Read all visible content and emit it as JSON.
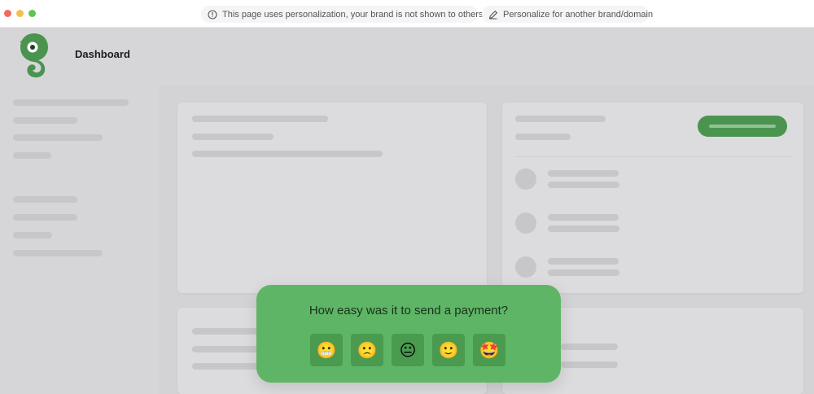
{
  "browser": {
    "notice": "This page uses personalization, your brand is not shown to others",
    "notice_icon": "info-circle-icon",
    "personalize_label": "Personalize for another brand/domain",
    "personalize_icon": "pencil-icon"
  },
  "app": {
    "title": "Dashboard",
    "brand_color": "#4b9450",
    "logo_icon": "chameleon-logo-icon"
  },
  "survey": {
    "question": "How easy was it to send a payment?",
    "background_color": "#5fb566",
    "options": [
      {
        "emoji": "😬",
        "icon": "grimacing-face-icon"
      },
      {
        "emoji": "🙁",
        "icon": "slightly-frowning-face-icon"
      },
      {
        "emoji": "😐",
        "icon": "neutral-face-icon"
      },
      {
        "emoji": "🙂",
        "icon": "slightly-smiling-face-icon"
      },
      {
        "emoji": "🤩",
        "icon": "star-struck-face-icon"
      }
    ]
  }
}
